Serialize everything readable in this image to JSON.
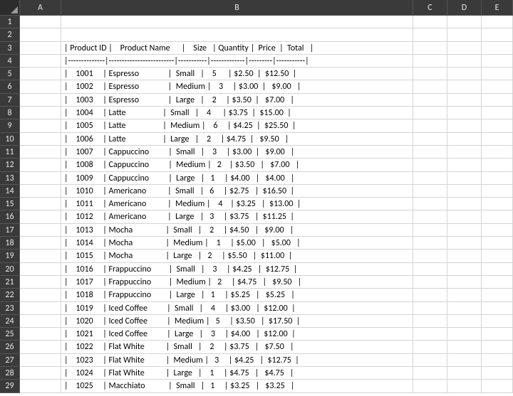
{
  "columns": [
    "A",
    "B",
    "C",
    "D",
    "E"
  ],
  "col_widths": {
    "A": "wA",
    "B": "wB",
    "C": "wC",
    "D": "wD",
    "E": "wE"
  },
  "rows": [
    1,
    2,
    3,
    4,
    5,
    6,
    7,
    8,
    9,
    10,
    11,
    12,
    13,
    14,
    15,
    16,
    17,
    18,
    19,
    20,
    21,
    22,
    23,
    24,
    25,
    26,
    27,
    28,
    29
  ],
  "cells": {
    "B3": "| Product ID |    Product Name      |    Size   | Quantity |  Price  |  Total   |",
    "B4": "|--------------|-------------------------|-----------|-------------|---------|-----------|",
    "B5": "|    1001     | Espresso               |  Small   |    5      | $2.50  |  $12.50  |",
    "B6": "|    1002     | Espresso               |  Medium |    3     | $3.00  |   $9.00   |",
    "B7": "|    1003     | Espresso               |  Large   |    2     | $3.50  |   $7.00   |",
    "B8": "|    1004     | Latte                   |  Small   |    4      | $3.75  |  $15.00  |",
    "B9": "|    1005     | Latte                   |  Medium |    6     | $4.25  |  $25.50  |",
    "B10": "|    1006     | Latte                   |  Large   |    2     | $4.75  |   $9.50   |",
    "B11": "|    1007     | Cappuccino          |  Small   |    3     | $3.00  |   $9.00   |",
    "B12": "|    1008     | Cappuccino          |  Medium |   2    | $3.50   |   $7.00   |",
    "B13": "|    1009     | Cappuccino          |  Large   |   1     | $4.00   |   $4.00   |",
    "B14": "|    1010     | Americano           |  Small   |   6     | $2.75   |  $16.50  |",
    "B15": "|    1011     | Americano           |  Medium |    4    | $3.25   |  $13.00  |",
    "B16": "|    1012     | Americano           |  Large   |   3     | $3.75   |  $11.25  |",
    "B17": "|    1013     | Mocha                 |  Small   |    2     | $4.50   |   $9.00   |",
    "B18": "|    1014     | Mocha                 |  Medium |    1     | $5.00   |   $5.00   |",
    "B19": "|    1015     | Mocha                 |  Large   |   2     | $5.50   |  $11.00  |",
    "B20": "|    1016     | Frappuccino         |  Small   |    3     | $4.25   |  $12.75  |",
    "B21": "|    1017     | Frappuccino         |  Medium |   2     | $4.75   |   $9.50   |",
    "B22": "|    1018     | Frappuccino         |  Large   |   1     | $5.25   |   $5.25   |",
    "B23": "|    1019     | Iced Coffee          |  Small   |    4     | $3.00   |  $12.00  |",
    "B24": "|    1020     | Iced Coffee          |  Medium |   5     | $3.50   |  $17.50  |",
    "B25": "|    1021     | Iced Coffee          |  Large   |    3     | $4.00   |  $12.00  |",
    "B26": "|    1022     | Flat White           |  Small   |    2     | $3.75   |   $7.50   |",
    "B27": "|    1023     | Flat White           |  Medium |   3     | $4.25   |  $12.75  |",
    "B28": "|    1024     | Flat White           |  Large   |    1     | $4.75   |   $4.75   |",
    "B29": "|    1025     | Macchiato            |  Small   |   1     | $3.25   |   $3.25   |"
  },
  "chart_data": {
    "type": "table",
    "title": "",
    "columns": [
      "Product ID",
      "Product Name",
      "Size",
      "Quantity",
      "Price",
      "Total"
    ],
    "rows": [
      {
        "Product ID": 1001,
        "Product Name": "Espresso",
        "Size": "Small",
        "Quantity": 5,
        "Price": "$2.50",
        "Total": "$12.50"
      },
      {
        "Product ID": 1002,
        "Product Name": "Espresso",
        "Size": "Medium",
        "Quantity": 3,
        "Price": "$3.00",
        "Total": "$9.00"
      },
      {
        "Product ID": 1003,
        "Product Name": "Espresso",
        "Size": "Large",
        "Quantity": 2,
        "Price": "$3.50",
        "Total": "$7.00"
      },
      {
        "Product ID": 1004,
        "Product Name": "Latte",
        "Size": "Small",
        "Quantity": 4,
        "Price": "$3.75",
        "Total": "$15.00"
      },
      {
        "Product ID": 1005,
        "Product Name": "Latte",
        "Size": "Medium",
        "Quantity": 6,
        "Price": "$4.25",
        "Total": "$25.50"
      },
      {
        "Product ID": 1006,
        "Product Name": "Latte",
        "Size": "Large",
        "Quantity": 2,
        "Price": "$4.75",
        "Total": "$9.50"
      },
      {
        "Product ID": 1007,
        "Product Name": "Cappuccino",
        "Size": "Small",
        "Quantity": 3,
        "Price": "$3.00",
        "Total": "$9.00"
      },
      {
        "Product ID": 1008,
        "Product Name": "Cappuccino",
        "Size": "Medium",
        "Quantity": 2,
        "Price": "$3.50",
        "Total": "$7.00"
      },
      {
        "Product ID": 1009,
        "Product Name": "Cappuccino",
        "Size": "Large",
        "Quantity": 1,
        "Price": "$4.00",
        "Total": "$4.00"
      },
      {
        "Product ID": 1010,
        "Product Name": "Americano",
        "Size": "Small",
        "Quantity": 6,
        "Price": "$2.75",
        "Total": "$16.50"
      },
      {
        "Product ID": 1011,
        "Product Name": "Americano",
        "Size": "Medium",
        "Quantity": 4,
        "Price": "$3.25",
        "Total": "$13.00"
      },
      {
        "Product ID": 1012,
        "Product Name": "Americano",
        "Size": "Large",
        "Quantity": 3,
        "Price": "$3.75",
        "Total": "$11.25"
      },
      {
        "Product ID": 1013,
        "Product Name": "Mocha",
        "Size": "Small",
        "Quantity": 2,
        "Price": "$4.50",
        "Total": "$9.00"
      },
      {
        "Product ID": 1014,
        "Product Name": "Mocha",
        "Size": "Medium",
        "Quantity": 1,
        "Price": "$5.00",
        "Total": "$5.00"
      },
      {
        "Product ID": 1015,
        "Product Name": "Mocha",
        "Size": "Large",
        "Quantity": 2,
        "Price": "$5.50",
        "Total": "$11.00"
      },
      {
        "Product ID": 1016,
        "Product Name": "Frappuccino",
        "Size": "Small",
        "Quantity": 3,
        "Price": "$4.25",
        "Total": "$12.75"
      },
      {
        "Product ID": 1017,
        "Product Name": "Frappuccino",
        "Size": "Medium",
        "Quantity": 2,
        "Price": "$4.75",
        "Total": "$9.50"
      },
      {
        "Product ID": 1018,
        "Product Name": "Frappuccino",
        "Size": "Large",
        "Quantity": 1,
        "Price": "$5.25",
        "Total": "$5.25"
      },
      {
        "Product ID": 1019,
        "Product Name": "Iced Coffee",
        "Size": "Small",
        "Quantity": 4,
        "Price": "$3.00",
        "Total": "$12.00"
      },
      {
        "Product ID": 1020,
        "Product Name": "Iced Coffee",
        "Size": "Medium",
        "Quantity": 5,
        "Price": "$3.50",
        "Total": "$17.50"
      },
      {
        "Product ID": 1021,
        "Product Name": "Iced Coffee",
        "Size": "Large",
        "Quantity": 3,
        "Price": "$4.00",
        "Total": "$12.00"
      },
      {
        "Product ID": 1022,
        "Product Name": "Flat White",
        "Size": "Small",
        "Quantity": 2,
        "Price": "$3.75",
        "Total": "$7.50"
      },
      {
        "Product ID": 1023,
        "Product Name": "Flat White",
        "Size": "Medium",
        "Quantity": 3,
        "Price": "$4.25",
        "Total": "$12.75"
      },
      {
        "Product ID": 1024,
        "Product Name": "Flat White",
        "Size": "Large",
        "Quantity": 1,
        "Price": "$4.75",
        "Total": "$4.75"
      },
      {
        "Product ID": 1025,
        "Product Name": "Macchiato",
        "Size": "Small",
        "Quantity": 1,
        "Price": "$3.25",
        "Total": "$3.25"
      }
    ]
  }
}
